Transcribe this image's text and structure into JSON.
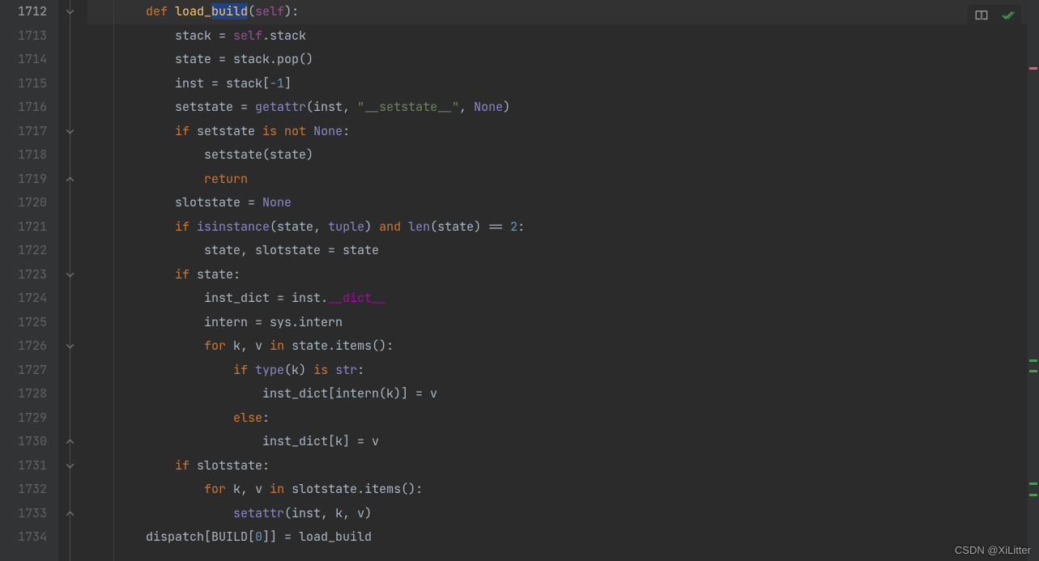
{
  "line_start": 1712,
  "highlight_line": 1712,
  "selection": {
    "line": 1712,
    "text": "build"
  },
  "watermark": "CSDN @XiLitter",
  "markers": [
    {
      "top_pct": 12,
      "cls": "mk-pink"
    },
    {
      "top_pct": 64,
      "cls": "mk-green"
    },
    {
      "top_pct": 66,
      "cls": "mk-green"
    },
    {
      "top_pct": 86,
      "cls": "mk-green"
    },
    {
      "top_pct": 88,
      "cls": "mk-green"
    }
  ],
  "fold_icons": [
    {
      "line": 1712,
      "dir": "down"
    },
    {
      "line": 1717,
      "dir": "down"
    },
    {
      "line": 1719,
      "dir": "up"
    },
    {
      "line": 1723,
      "dir": "down"
    },
    {
      "line": 1726,
      "dir": "down"
    },
    {
      "line": 1730,
      "dir": "up"
    },
    {
      "line": 1731,
      "dir": "down"
    },
    {
      "line": 1733,
      "dir": "up"
    }
  ],
  "code": [
    {
      "n": 1712,
      "indent": 8,
      "tokens": [
        [
          "kw",
          "def "
        ],
        [
          "fn",
          "load_"
        ],
        [
          "sel",
          "build"
        ],
        [
          "op",
          "("
        ],
        [
          "self",
          "self"
        ],
        [
          "op",
          "):"
        ]
      ]
    },
    {
      "n": 1713,
      "indent": 12,
      "tokens": [
        [
          "id",
          "stack = "
        ],
        [
          "self",
          "self"
        ],
        [
          "id",
          ".stack"
        ]
      ]
    },
    {
      "n": 1714,
      "indent": 12,
      "tokens": [
        [
          "id",
          "state = stack.pop()"
        ]
      ]
    },
    {
      "n": 1715,
      "indent": 12,
      "tokens": [
        [
          "id",
          "inst = stack["
        ],
        [
          "num",
          "-1"
        ],
        [
          "id",
          "]"
        ]
      ]
    },
    {
      "n": 1716,
      "indent": 12,
      "tokens": [
        [
          "id",
          "setstate = "
        ],
        [
          "builtin",
          "getattr"
        ],
        [
          "id",
          "(inst"
        ],
        [
          "op",
          ", "
        ],
        [
          "str",
          "\"__setstate__\""
        ],
        [
          "op",
          ", "
        ],
        [
          "builtin",
          "None"
        ],
        [
          "id",
          ")"
        ]
      ]
    },
    {
      "n": 1717,
      "indent": 12,
      "tokens": [
        [
          "kw",
          "if "
        ],
        [
          "id",
          "setstate "
        ],
        [
          "kw",
          "is not "
        ],
        [
          "builtin",
          "None"
        ],
        [
          "op",
          ":"
        ]
      ]
    },
    {
      "n": 1718,
      "indent": 16,
      "tokens": [
        [
          "id",
          "setstate(state)"
        ]
      ]
    },
    {
      "n": 1719,
      "indent": 16,
      "tokens": [
        [
          "kw",
          "return"
        ]
      ]
    },
    {
      "n": 1720,
      "indent": 12,
      "tokens": [
        [
          "id",
          "slotstate = "
        ],
        [
          "builtin",
          "None"
        ]
      ]
    },
    {
      "n": 1721,
      "indent": 12,
      "tokens": [
        [
          "kw",
          "if "
        ],
        [
          "builtin",
          "isinstance"
        ],
        [
          "id",
          "(state"
        ],
        [
          "op",
          ", "
        ],
        [
          "builtin",
          "tuple"
        ],
        [
          "id",
          ") "
        ],
        [
          "kw",
          "and "
        ],
        [
          "builtin",
          "len"
        ],
        [
          "id",
          "(state) == "
        ],
        [
          "num",
          "2"
        ],
        [
          "op",
          ":"
        ]
      ]
    },
    {
      "n": 1722,
      "indent": 16,
      "tokens": [
        [
          "id",
          "state"
        ],
        [
          "op",
          ", "
        ],
        [
          "id",
          "slotstate = state"
        ]
      ]
    },
    {
      "n": 1723,
      "indent": 12,
      "tokens": [
        [
          "kw",
          "if "
        ],
        [
          "id",
          "state"
        ],
        [
          "op",
          ":"
        ]
      ]
    },
    {
      "n": 1724,
      "indent": 16,
      "tokens": [
        [
          "id",
          "inst_dict = inst."
        ],
        [
          "dunder",
          "__dict__"
        ]
      ]
    },
    {
      "n": 1725,
      "indent": 16,
      "tokens": [
        [
          "id",
          "intern = sys.intern"
        ]
      ]
    },
    {
      "n": 1726,
      "indent": 16,
      "tokens": [
        [
          "kw",
          "for "
        ],
        [
          "id",
          "k"
        ],
        [
          "op",
          ", "
        ],
        [
          "id",
          "v "
        ],
        [
          "kw",
          "in "
        ],
        [
          "id",
          "state.items()"
        ],
        [
          "op",
          ":"
        ]
      ]
    },
    {
      "n": 1727,
      "indent": 20,
      "tokens": [
        [
          "kw",
          "if "
        ],
        [
          "builtin",
          "type"
        ],
        [
          "id",
          "(k) "
        ],
        [
          "kw",
          "is "
        ],
        [
          "builtin",
          "str"
        ],
        [
          "op",
          ":"
        ]
      ]
    },
    {
      "n": 1728,
      "indent": 24,
      "tokens": [
        [
          "id",
          "inst_dict[intern(k)] = v"
        ]
      ]
    },
    {
      "n": 1729,
      "indent": 20,
      "tokens": [
        [
          "kw",
          "else"
        ],
        [
          "op",
          ":"
        ]
      ]
    },
    {
      "n": 1730,
      "indent": 24,
      "tokens": [
        [
          "id",
          "inst_dict[k] = v"
        ]
      ]
    },
    {
      "n": 1731,
      "indent": 12,
      "tokens": [
        [
          "kw",
          "if "
        ],
        [
          "id",
          "slotstate"
        ],
        [
          "op",
          ":"
        ]
      ]
    },
    {
      "n": 1732,
      "indent": 16,
      "tokens": [
        [
          "kw",
          "for "
        ],
        [
          "id",
          "k"
        ],
        [
          "op",
          ", "
        ],
        [
          "id",
          "v "
        ],
        [
          "kw",
          "in "
        ],
        [
          "id",
          "slotstate.items()"
        ],
        [
          "op",
          ":"
        ]
      ]
    },
    {
      "n": 1733,
      "indent": 20,
      "tokens": [
        [
          "builtin",
          "setattr"
        ],
        [
          "id",
          "(inst"
        ],
        [
          "op",
          ", "
        ],
        [
          "id",
          "k"
        ],
        [
          "op",
          ", "
        ],
        [
          "id",
          "v)"
        ]
      ]
    },
    {
      "n": 1734,
      "indent": 8,
      "tokens": [
        [
          "id",
          "dispatch[BUILD["
        ],
        [
          "num",
          "0"
        ],
        [
          "id",
          "]] = load_build"
        ]
      ]
    }
  ]
}
